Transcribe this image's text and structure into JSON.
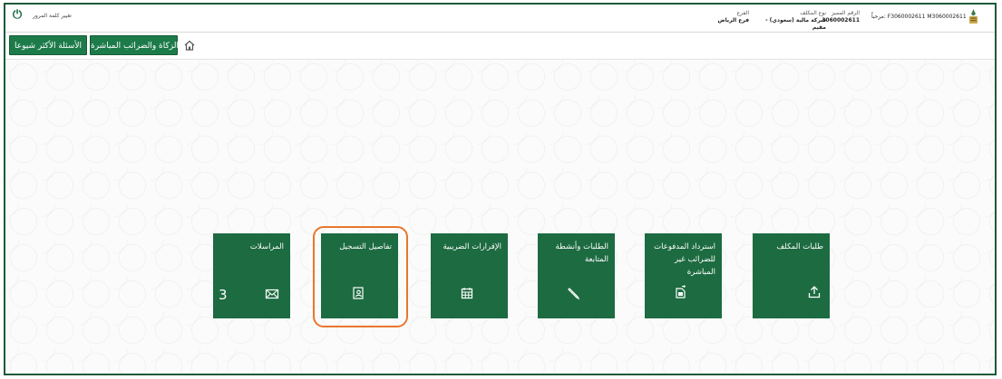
{
  "topbar": {
    "change_password": "تغيير كلمة المرور",
    "branch": {
      "label": "الفرع",
      "value": "فرع الرياض"
    },
    "taxpayer_type": {
      "label": "نوع المكلف",
      "value": "شركة مالية (سعودي) - مقيم"
    },
    "tin": {
      "label": "الرقم المميز",
      "value": "3060002611"
    },
    "welcome": "مرحباً: F3060002611 M3060002611"
  },
  "nav": {
    "faq": "الأسئلة الأكثر شيوعا",
    "zakat": "الزكاة والضرائب المباشرة"
  },
  "tiles": [
    {
      "id": "taxpayer-requests",
      "title": "طلبات المكلف",
      "icon": "upload-icon"
    },
    {
      "id": "refund",
      "title": "استرداد المدفوعات للضرائب غير المباشرة",
      "icon": "refund-document-icon"
    },
    {
      "id": "requests-followup",
      "title": "الطلبات وأنشطة المتابعة",
      "icon": "pencil-icon"
    },
    {
      "id": "tax-returns",
      "title": "الإقرارات الضريبية",
      "icon": "calendar-icon"
    },
    {
      "id": "registration-details",
      "title": "تفاصيل التسجيل",
      "icon": "contact-card-icon"
    },
    {
      "id": "correspondence",
      "title": "المراسلات",
      "icon": "envelope-icon",
      "count": "3"
    }
  ],
  "colors": {
    "tile": "#1d6b41",
    "highlight": "#e8772b",
    "nav_button": "#1d7b4a"
  }
}
